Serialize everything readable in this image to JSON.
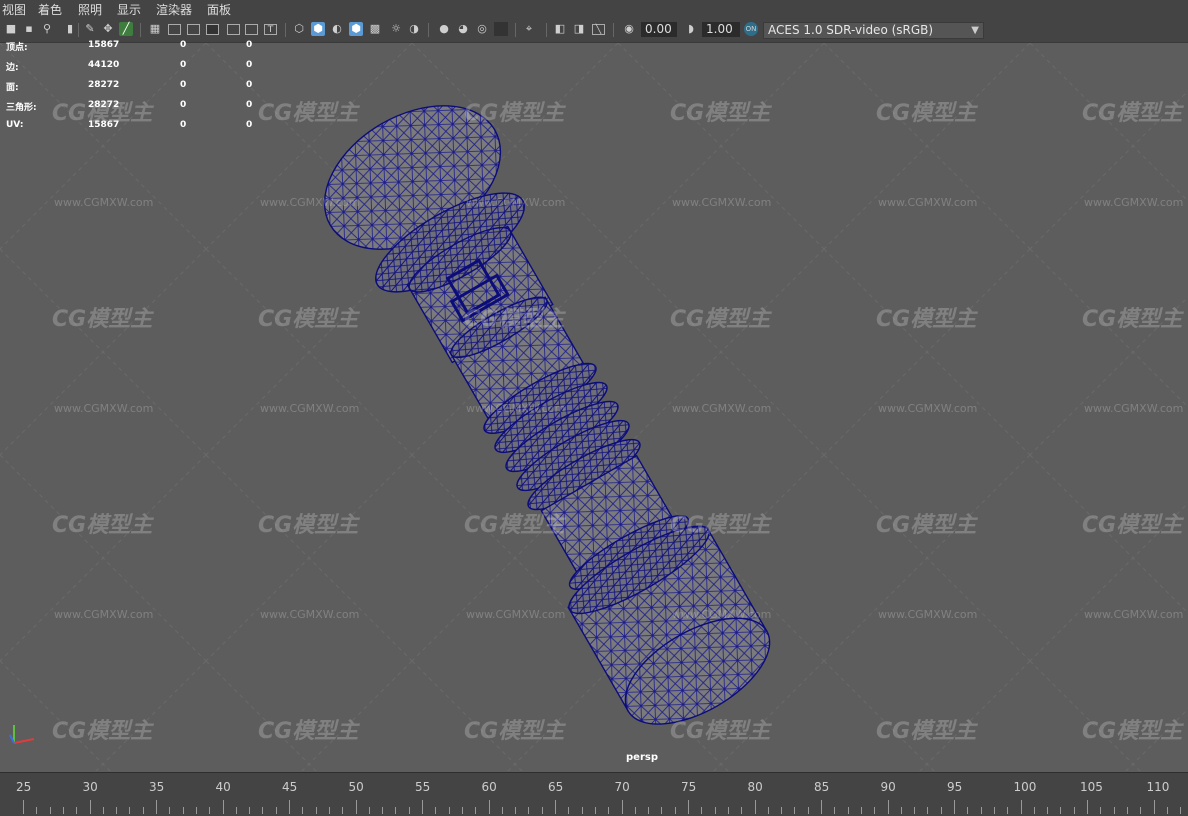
{
  "menu": {
    "items": [
      "视图",
      "着色",
      "照明",
      "显示",
      "渲染器",
      "面板"
    ]
  },
  "toolbar": {
    "exposure": "0.00",
    "gamma": "1.00",
    "color_space": "ACES 1.0 SDR-video (sRGB)"
  },
  "hud": {
    "rows": [
      {
        "label": "顶点:",
        "count": "15867",
        "sel": "0",
        "comp": "0"
      },
      {
        "label": "边:",
        "count": "44120",
        "sel": "0",
        "comp": "0"
      },
      {
        "label": "面:",
        "count": "28272",
        "sel": "0",
        "comp": "0"
      },
      {
        "label": "三角形:",
        "count": "28272",
        "sel": "0",
        "comp": "0"
      },
      {
        "label": "UV:",
        "count": "15867",
        "sel": "0",
        "comp": "0"
      }
    ]
  },
  "viewport": {
    "camera_label": "persp",
    "watermark_logo": "CG模型主",
    "watermark_url": "www.CGMXW.com"
  },
  "timeline": {
    "ticks": [
      "25",
      "30",
      "35",
      "40",
      "45",
      "50",
      "55",
      "60",
      "65",
      "70",
      "75",
      "80",
      "85",
      "90",
      "95",
      "100",
      "105",
      "110"
    ]
  },
  "colors": {
    "wire": "#1a1a8c",
    "mesh": "#7b7b7b",
    "bg": "#5d5d5d"
  }
}
